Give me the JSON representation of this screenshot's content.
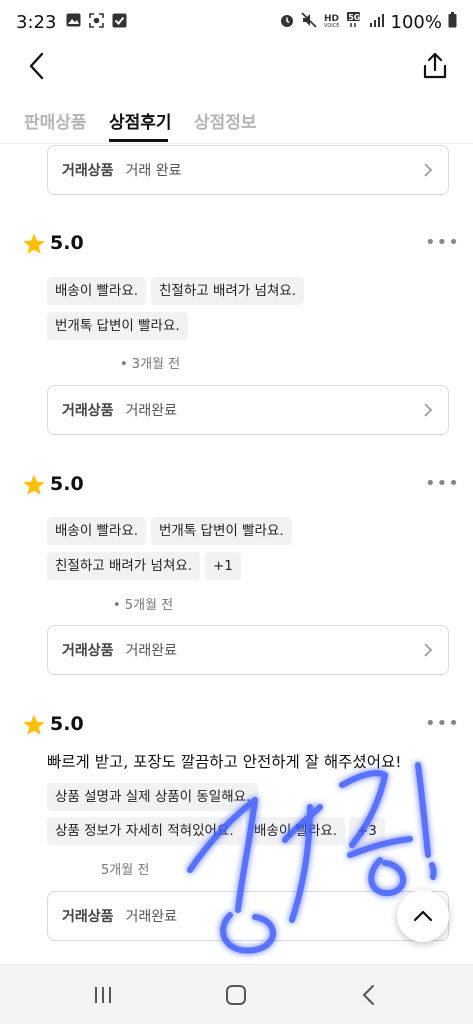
{
  "status_bar": {
    "time": "3:23",
    "left_icons": [
      "image-icon",
      "screenshot-icon",
      "checkbox-icon"
    ],
    "right_icons": [
      "alarm-icon",
      "mute-icon",
      "hd-voice-icon",
      "5g-icon",
      "signal-icon"
    ],
    "battery_text": "100%"
  },
  "tabs": [
    {
      "label": "판매상품",
      "active": false
    },
    {
      "label": "상점후기",
      "active": true
    },
    {
      "label": "상점정보",
      "active": false
    }
  ],
  "reviews": [
    {
      "trade_label": "거래상품",
      "trade_status": "거래 완료"
    },
    {
      "rating": "5.0",
      "tags": [
        "배송이 빨라요.",
        "친절하고 배려가 넘쳐요.",
        "번개톡 답변이 빨라요."
      ],
      "time_ago": "• 3개월 전",
      "trade_label": "거래상품",
      "trade_status": "거래완료"
    },
    {
      "rating": "5.0",
      "tags": [
        "배송이 빨라요.",
        "번개톡 답변이 빨라요.",
        "친절하고 배려가 넘쳐요.",
        "+1"
      ],
      "time_ago": "• 5개월 전",
      "trade_label": "거래상품",
      "trade_status": "거래완료"
    },
    {
      "rating": "5.0",
      "text": "빠르게 받고, 포장도 깔끔하고 안전하게 잘 해주셨어요!",
      "tags": [
        "상품 설명과 실제 상품이 동일해요.",
        "상품 정보가 자세히 적혀있어요.",
        "배송이 빨라요.",
        "+3"
      ],
      "time_ago": "5개월 전",
      "trade_label": "거래상품",
      "trade_status": "거래완료"
    }
  ],
  "colors": {
    "star": "#FFC107",
    "signature": "#3D5AFE",
    "tab_active": "#111111",
    "tab_inactive": "#B5B5B5"
  }
}
